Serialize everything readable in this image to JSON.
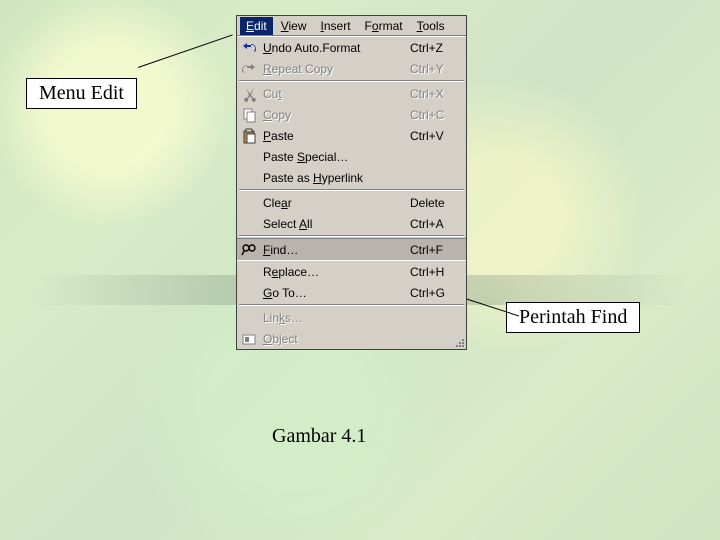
{
  "callouts": {
    "edit_menu": "Menu Edit",
    "find_cmd": "Perintah Find"
  },
  "caption": "Gambar 4.1",
  "menubar": {
    "items": [
      {
        "label": "Edit",
        "u": 0,
        "active": true
      },
      {
        "label": "View",
        "u": 0,
        "active": false
      },
      {
        "label": "Insert",
        "u": 0,
        "active": false
      },
      {
        "label": "Format",
        "u": 1,
        "active": false
      },
      {
        "label": "Tools",
        "u": 0,
        "active": false
      }
    ]
  },
  "menu_groups": [
    [
      {
        "label": "Undo Auto.Format",
        "u": 0,
        "shortcut": "Ctrl+Z",
        "icon": "undo",
        "enabled": true
      },
      {
        "label": "Repeat Copy",
        "u": 0,
        "shortcut": "Ctrl+Y",
        "icon": "redo",
        "enabled": false
      }
    ],
    [
      {
        "label": "Cut",
        "u": 2,
        "shortcut": "Ctrl+X",
        "icon": "cut",
        "enabled": false
      },
      {
        "label": "Copy",
        "u": 0,
        "shortcut": "Ctrl+C",
        "icon": "copy",
        "enabled": false
      },
      {
        "label": "Paste",
        "u": 0,
        "shortcut": "Ctrl+V",
        "icon": "paste",
        "enabled": true
      },
      {
        "label": "Paste Special…",
        "u": 6,
        "shortcut": "",
        "icon": "",
        "enabled": true
      },
      {
        "label": "Paste as Hyperlink",
        "u": 9,
        "shortcut": "",
        "icon": "",
        "enabled": true
      }
    ],
    [
      {
        "label": "Clear",
        "u": 3,
        "shortcut": "Delete",
        "icon": "",
        "enabled": true,
        "submenu": false
      },
      {
        "label": "Select All",
        "u": 7,
        "shortcut": "Ctrl+A",
        "icon": "",
        "enabled": true
      }
    ],
    [
      {
        "label": "Find…",
        "u": 0,
        "shortcut": "Ctrl+F",
        "icon": "find",
        "enabled": true,
        "selected": true
      },
      {
        "label": "Replace…",
        "u": 1,
        "shortcut": "Ctrl+H",
        "icon": "",
        "enabled": true
      },
      {
        "label": "Go To…",
        "u": 0,
        "shortcut": "Ctrl+G",
        "icon": "",
        "enabled": true
      }
    ],
    [
      {
        "label": "Links…",
        "u": 3,
        "shortcut": "",
        "icon": "",
        "enabled": false
      },
      {
        "label": "Object",
        "u": 0,
        "shortcut": "",
        "icon": "object",
        "enabled": false
      }
    ]
  ]
}
